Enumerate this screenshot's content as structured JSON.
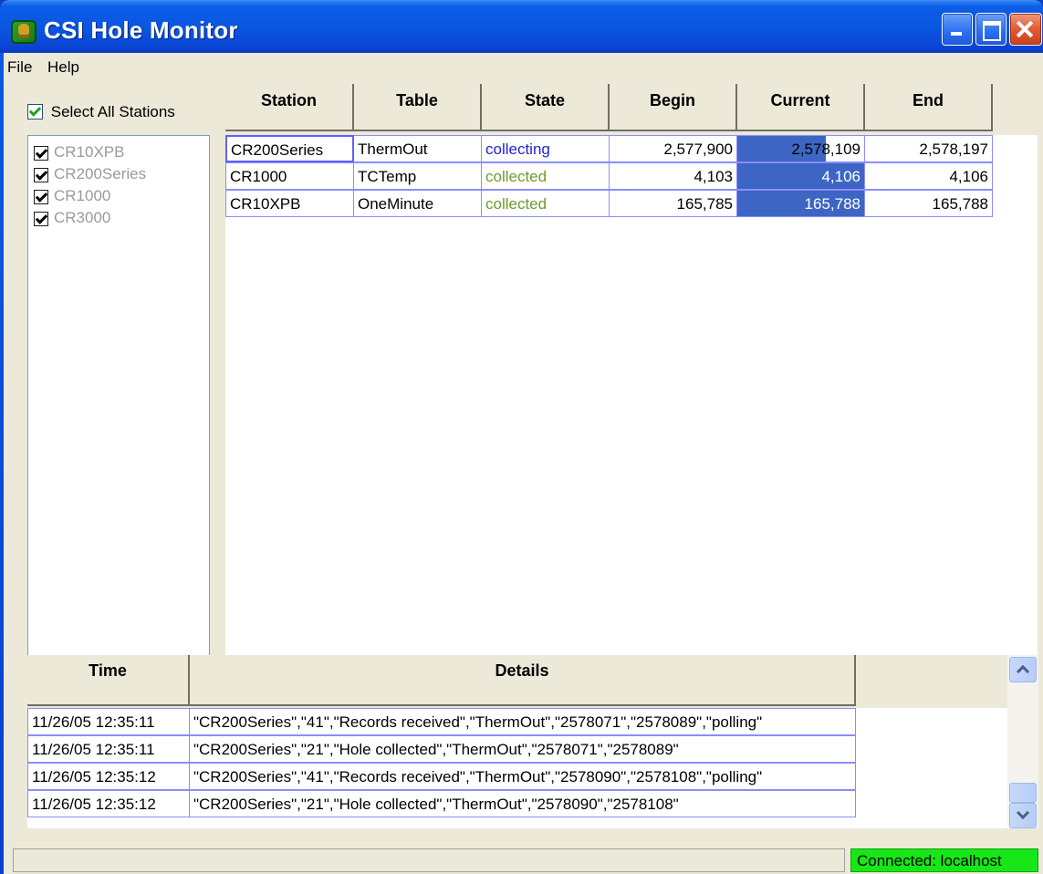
{
  "window": {
    "title": "CSI Hole Monitor"
  },
  "menu": [
    "File",
    "Help"
  ],
  "select_all_label": "Select All Stations",
  "stations": [
    "CR10XPB",
    "CR200Series",
    "CR1000",
    "CR3000"
  ],
  "grid": {
    "columns": [
      "Station",
      "Table",
      "State",
      "Begin",
      "Current",
      "End"
    ],
    "rows": [
      {
        "station": "CR200Series",
        "table": "ThermOut",
        "state": "collecting",
        "begin": "2,577,900",
        "current": "2,578,109",
        "end": "2,578,197",
        "progress": 0.7
      },
      {
        "station": "CR1000",
        "table": "TCTemp",
        "state": "collected",
        "begin": "4,103",
        "current": "4,106",
        "end": "4,106",
        "progress": 1.0
      },
      {
        "station": "CR10XPB",
        "table": "OneMinute",
        "state": "collected",
        "begin": "165,785",
        "current": "165,788",
        "end": "165,788",
        "progress": 1.0
      }
    ]
  },
  "log": {
    "columns": [
      "Time",
      "Details"
    ],
    "rows": [
      {
        "time": "11/26/05 12:35:11",
        "details": "\"CR200Series\",\"41\",\"Records received\",\"ThermOut\",\"2578071\",\"2578089\",\"polling\""
      },
      {
        "time": "11/26/05 12:35:11",
        "details": "\"CR200Series\",\"21\",\"Hole collected\",\"ThermOut\",\"2578071\",\"2578089\""
      },
      {
        "time": "11/26/05 12:35:12",
        "details": "\"CR200Series\",\"41\",\"Records received\",\"ThermOut\",\"2578090\",\"2578108\",\"polling\""
      },
      {
        "time": "11/26/05 12:35:12",
        "details": "\"CR200Series\",\"21\",\"Hole collected\",\"ThermOut\",\"2578090\",\"2578108\""
      }
    ]
  },
  "status": {
    "connection": "Connected: localhost"
  },
  "colors": {
    "collecting": "#1f1fd6",
    "collected": "#6f9a2a",
    "connected": "#17e617",
    "progress": "#3d66c4"
  }
}
